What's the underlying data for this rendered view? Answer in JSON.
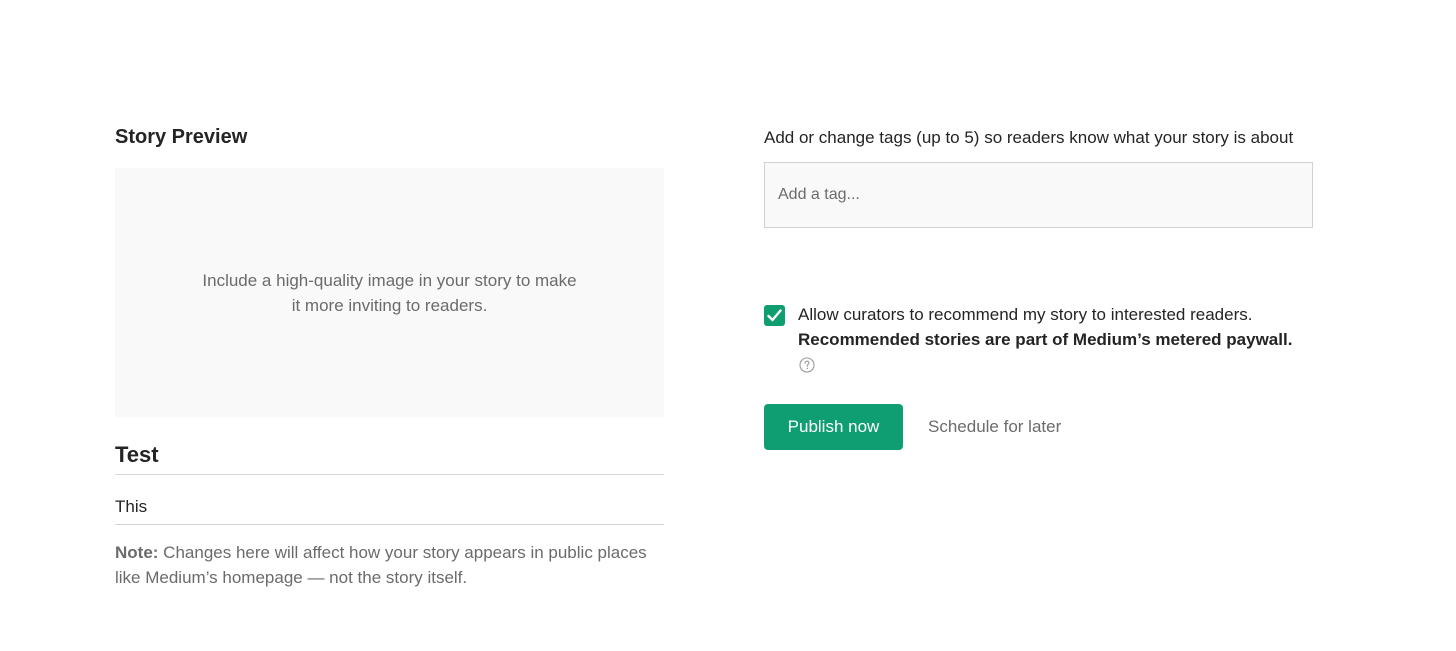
{
  "preview": {
    "heading": "Story Preview",
    "image_prompt": "Include a high-quality image in your story to make it more inviting to readers.",
    "title": "Test",
    "subtitle": "This",
    "note_label": "Note:",
    "note_text": " Changes here will affect how your story appears in public places like Medium’s homepage — not the story itself."
  },
  "tags": {
    "label": "Add or change tags (up to 5) so readers know what your story is about",
    "placeholder": "Add a tag..."
  },
  "curation": {
    "checked": true,
    "text": "Allow curators to recommend my story to interested readers.",
    "bold_text": "Recommended stories are part of Medium’s metered paywall.",
    "help_icon": "question-circle-icon"
  },
  "actions": {
    "publish_label": "Publish now",
    "schedule_label": "Schedule for later"
  },
  "colors": {
    "accent": "#0f9e72",
    "muted_text": "#6b6b6b",
    "placeholder_bg": "#f9f9f9"
  }
}
